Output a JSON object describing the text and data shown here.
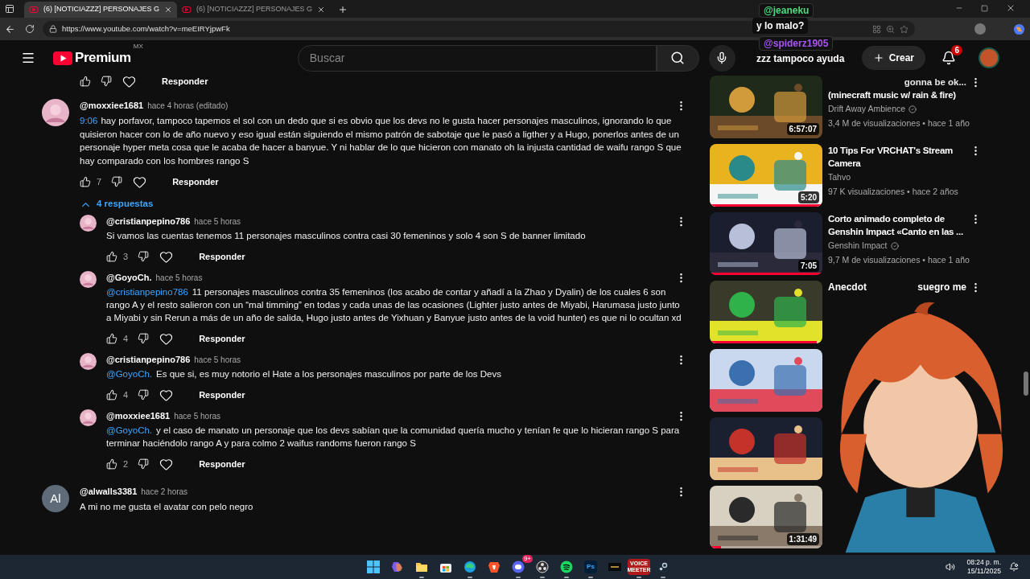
{
  "browser": {
    "tabs": [
      {
        "title": "(6) [NOTICIAZZZ] PERSONAJES G",
        "selected": true
      },
      {
        "title": "(6) [NOTICIAZZZ] PERSONAJES G",
        "selected": false
      }
    ],
    "url": "https://www.youtube.com/watch?v=meEIRYjpwFk"
  },
  "header": {
    "logo": "Premium",
    "region": "MX",
    "search": {
      "placeholder": "Buscar"
    },
    "create": "Crear",
    "notifications": "6"
  },
  "comments": {
    "previous_reply": "Responder",
    "threads": [
      {
        "author": "@moxxiee1681",
        "time": "hace 4 horas (editado)",
        "timestamp": "9:06",
        "text": "hay porfavor, tampoco tapemos el sol con un dedo que si es obvio que los devs no le gusta hacer personajes masculinos, ignorando lo que quisieron hacer con lo de año nuevo y eso igual están siguiendo el mismo patrón de sabotaje que le pasó a ligther y a Hugo, ponerlos antes de un personaje hyper meta cosa que le acaba de hacer a banyue. Y ni hablar de lo que hicieron con manato oh la injusta cantidad de waifu rango S que hay comparado con los hombres rango S",
        "likes": "7",
        "reply": "Responder",
        "replies_toggle": {
          "label": "4 respuestas",
          "expanded": true
        },
        "replies": [
          {
            "author": "@cristianpepino786",
            "time": "hace 5 horas",
            "text": "Si vamos las cuentas tenemos 11 personajes masculinos contra casi 30 femeninos y solo 4 son S de banner limitado",
            "likes": "3",
            "reply": "Responder"
          },
          {
            "author": "@GoyoCh.",
            "time": "hace 5 horas",
            "mention": "@cristianpepino786",
            "text": "11 personajes masculinos contra 35 femeninos (los acabo de contar y añadí a la Zhao y Dyalin) de los cuales 6 son rango A y el resto salieron con un “mal timming” en todas y cada unas de las ocasiones (Lighter justo antes de Miyabi, Harumasa justo junto a Miyabi y sin Rerun a más de un año de salida, Hugo justo antes de Yixhuan y Banyue justo antes de la void hunter) es que ni lo ocultan xd",
            "likes": "4",
            "reply": "Responder"
          },
          {
            "author": "@cristianpepino786",
            "time": "hace 5 horas",
            "mention": "@GoyoCh.",
            "text": "Es que si, es muy notorio el Hate a los personajes masculinos por parte de los Devs",
            "likes": "4",
            "reply": "Responder"
          },
          {
            "author": "@moxxiee1681",
            "time": "hace 5 horas",
            "mention": "@GoyoCh.",
            "text": "y el caso de manato un personaje que los devs sabían que la comunidad quería mucho y tenían fe que lo hicieran rango S para terminar haciéndolo rango A y para colmo 2 waifus randoms fueron rango S",
            "likes": "2",
            "reply": "Responder"
          }
        ]
      },
      {
        "author": "@alwalls3381",
        "time": "hace 2 horas",
        "avatar": {
          "kind": "letter",
          "initials": "Al"
        },
        "text": "A mi no me gusta el avatar con pelo negro"
      }
    ]
  },
  "sidebar": [
    {
      "kind": "covered_start",
      "title": [
        "gonna be ok...",
        "(minecraft music w/ rain & fire)"
      ],
      "channel": "Drift Away Ambience",
      "verified": true,
      "meta": "3,4 M de visualizaciones • hace 1 año",
      "duration": "6:57:07"
    },
    {
      "kind": "full",
      "title": [
        "10 Tips For VRCHAT's Stream Camera"
      ],
      "channel": "Tahvo",
      "meta": "97 K visualizaciones • hace 2 años",
      "duration": "5:20",
      "level": 1
    },
    {
      "kind": "full",
      "title": [
        "Corto animado completo de Genshin Impact «Canto en las ..."
      ],
      "channel": "Genshin Impact",
      "verified": true,
      "meta": "9,7 M de visualizaciones • hace 1 año",
      "duration": "7:05",
      "level": 1
    },
    {
      "kind": "covered_middle",
      "title": [
        "Anecdot",
        "suegro me"
      ],
      "level": 0.95
    },
    {
      "kind": "covered"
    },
    {
      "kind": "covered"
    },
    {
      "kind": "covered",
      "duration": "1:31:49",
      "level": 0.1
    }
  ],
  "chat": [
    {
      "user": "@jeaneku",
      "color": "#4ade80",
      "message": "y lo malo?"
    },
    {
      "user": "@spiderz1905",
      "color": "#a855f7",
      "message": "zzz tampoco ayuda"
    }
  ],
  "taskbar": {
    "apps": [
      {
        "kind": "windows",
        "active": false
      },
      {
        "kind": "copilot",
        "active": false
      },
      {
        "kind": "folder",
        "active": true
      },
      {
        "kind": "store",
        "active": false
      },
      {
        "kind": "edge",
        "active": true
      },
      {
        "kind": "brave",
        "active": false
      },
      {
        "kind": "discord",
        "badge": "9+",
        "active": true
      },
      {
        "kind": "obs",
        "active": true
      },
      {
        "kind": "spotify",
        "active": true
      },
      {
        "kind": "ps",
        "label": "Ps",
        "active": true
      },
      {
        "kind": "dark",
        "active": false
      },
      {
        "kind": "voice",
        "label": "VOICE MEETER",
        "active": true
      },
      {
        "kind": "steam",
        "active": true
      }
    ],
    "time": "08:24 p. m.",
    "date": "15/11/2025"
  }
}
